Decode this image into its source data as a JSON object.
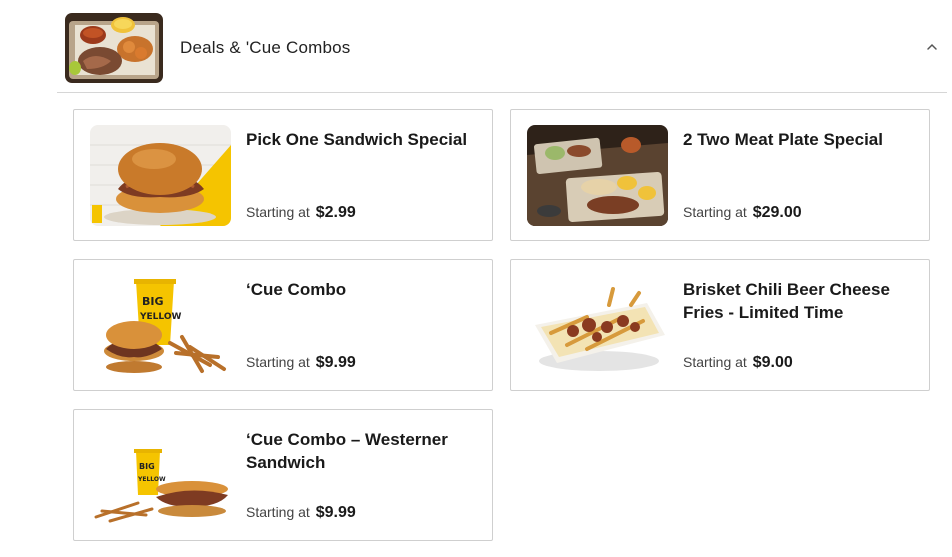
{
  "category": {
    "title": "Deals & 'Cue Combos",
    "thumbnail_icon": "bbq-platter-image",
    "toggle_icon": "chevron-up-icon"
  },
  "items": [
    {
      "title": "Pick One Sandwich Special",
      "price_prefix": "Starting at",
      "price": "$2.99",
      "image": "pulled-pork-sandwich-image"
    },
    {
      "title": "2 Two Meat Plate Special",
      "price_prefix": "Starting at",
      "price": "$29.00",
      "image": "two-meat-plate-image"
    },
    {
      "title": "‘Cue Combo",
      "price_prefix": "Starting at",
      "price": "$9.99",
      "image": "cue-combo-image"
    },
    {
      "title": "Brisket Chili Beer Cheese Fries - Limited Time",
      "price_prefix": "Starting at",
      "price": "$9.00",
      "image": "chili-cheese-fries-image"
    },
    {
      "title": "‘Cue Combo – Westerner Sandwich",
      "price_prefix": "Starting at",
      "price": "$9.99",
      "image": "westerner-combo-image"
    }
  ],
  "colors": {
    "brand_yellow": "#f5c400",
    "border": "#cfcfcf",
    "divider": "#d6d6d6"
  }
}
